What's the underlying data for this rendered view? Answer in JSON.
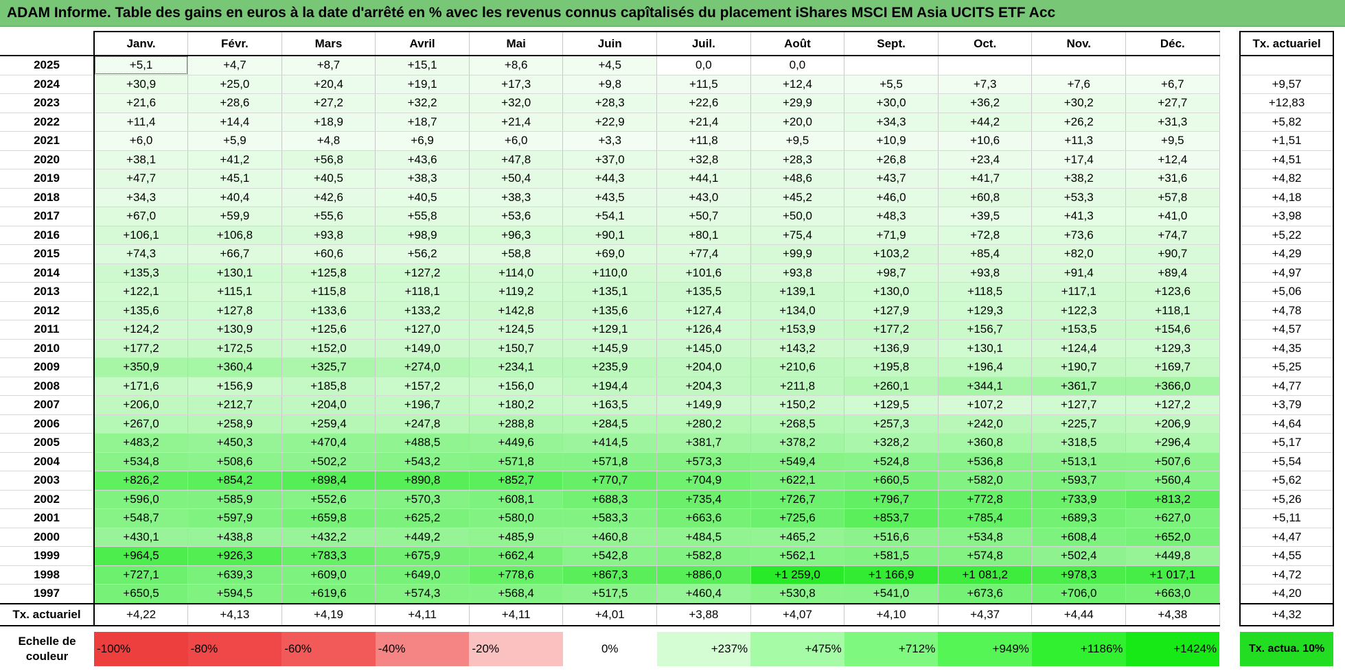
{
  "title": "ADAM Informe. Table des gains en euros à la date d'arrêté en % avec les revenus connus capîtalisés du placement iShares MSCI EM Asia UCITS ETF Acc",
  "months": [
    "Janv.",
    "Févr.",
    "Mars",
    "Avril",
    "Mai",
    "Juin",
    "Juil.",
    "Août",
    "Sept.",
    "Oct.",
    "Nov.",
    "Déc."
  ],
  "actuarial_header": "Tx. actuariel",
  "rows": [
    {
      "year": "2025",
      "values": [
        "+5,1",
        "+4,7",
        "+8,7",
        "+15,1",
        "+8,6",
        "+4,5",
        "0,0",
        "0,0",
        "",
        "",
        "",
        ""
      ],
      "actuarial": ""
    },
    {
      "year": "2024",
      "values": [
        "+30,9",
        "+25,0",
        "+20,4",
        "+19,1",
        "+17,3",
        "+9,8",
        "+11,5",
        "+12,4",
        "+5,5",
        "+7,3",
        "+7,6",
        "+6,7"
      ],
      "actuarial": "+9,57"
    },
    {
      "year": "2023",
      "values": [
        "+21,6",
        "+28,6",
        "+27,2",
        "+32,2",
        "+32,0",
        "+28,3",
        "+22,6",
        "+29,9",
        "+30,0",
        "+36,2",
        "+30,2",
        "+27,7"
      ],
      "actuarial": "+12,83"
    },
    {
      "year": "2022",
      "values": [
        "+11,4",
        "+14,4",
        "+18,9",
        "+18,7",
        "+21,4",
        "+22,9",
        "+21,4",
        "+20,0",
        "+34,3",
        "+44,2",
        "+26,2",
        "+31,3"
      ],
      "actuarial": "+5,82"
    },
    {
      "year": "2021",
      "values": [
        "+6,0",
        "+5,9",
        "+4,8",
        "+6,9",
        "+6,0",
        "+3,3",
        "+11,8",
        "+9,5",
        "+10,9",
        "+10,6",
        "+11,3",
        "+9,5"
      ],
      "actuarial": "+1,51"
    },
    {
      "year": "2020",
      "values": [
        "+38,1",
        "+41,2",
        "+56,8",
        "+43,6",
        "+47,8",
        "+37,0",
        "+32,8",
        "+28,3",
        "+26,8",
        "+23,4",
        "+17,4",
        "+12,4"
      ],
      "actuarial": "+4,51"
    },
    {
      "year": "2019",
      "values": [
        "+47,7",
        "+45,1",
        "+40,5",
        "+38,3",
        "+50,4",
        "+44,3",
        "+44,1",
        "+48,6",
        "+43,7",
        "+41,7",
        "+38,2",
        "+31,6"
      ],
      "actuarial": "+4,82"
    },
    {
      "year": "2018",
      "values": [
        "+34,3",
        "+40,4",
        "+42,6",
        "+40,5",
        "+38,3",
        "+43,5",
        "+43,0",
        "+45,2",
        "+46,0",
        "+60,8",
        "+53,3",
        "+57,8"
      ],
      "actuarial": "+4,18"
    },
    {
      "year": "2017",
      "values": [
        "+67,0",
        "+59,9",
        "+55,6",
        "+55,8",
        "+53,6",
        "+54,1",
        "+50,7",
        "+50,0",
        "+48,3",
        "+39,5",
        "+41,3",
        "+41,0"
      ],
      "actuarial": "+3,98"
    },
    {
      "year": "2016",
      "values": [
        "+106,1",
        "+106,8",
        "+93,8",
        "+98,9",
        "+96,3",
        "+90,1",
        "+80,1",
        "+75,4",
        "+71,9",
        "+72,8",
        "+73,6",
        "+74,7"
      ],
      "actuarial": "+5,22"
    },
    {
      "year": "2015",
      "values": [
        "+74,3",
        "+66,7",
        "+60,6",
        "+56,2",
        "+58,8",
        "+69,0",
        "+77,4",
        "+99,9",
        "+103,2",
        "+85,4",
        "+82,0",
        "+90,7"
      ],
      "actuarial": "+4,29"
    },
    {
      "year": "2014",
      "values": [
        "+135,3",
        "+130,1",
        "+125,8",
        "+127,2",
        "+114,0",
        "+110,0",
        "+101,6",
        "+93,8",
        "+98,7",
        "+93,8",
        "+91,4",
        "+89,4"
      ],
      "actuarial": "+4,97"
    },
    {
      "year": "2013",
      "values": [
        "+122,1",
        "+115,1",
        "+115,8",
        "+118,1",
        "+119,2",
        "+135,1",
        "+135,5",
        "+139,1",
        "+130,0",
        "+118,5",
        "+117,1",
        "+123,6"
      ],
      "actuarial": "+5,06"
    },
    {
      "year": "2012",
      "values": [
        "+135,6",
        "+127,8",
        "+133,6",
        "+133,2",
        "+142,8",
        "+135,6",
        "+127,4",
        "+134,0",
        "+127,9",
        "+129,3",
        "+122,3",
        "+118,1"
      ],
      "actuarial": "+4,78"
    },
    {
      "year": "2011",
      "values": [
        "+124,2",
        "+130,9",
        "+125,6",
        "+127,0",
        "+124,5",
        "+129,1",
        "+126,4",
        "+153,9",
        "+177,2",
        "+156,7",
        "+153,5",
        "+154,6"
      ],
      "actuarial": "+4,57"
    },
    {
      "year": "2010",
      "values": [
        "+177,2",
        "+172,5",
        "+152,0",
        "+149,0",
        "+150,7",
        "+145,9",
        "+145,0",
        "+143,2",
        "+136,9",
        "+130,1",
        "+124,4",
        "+129,3"
      ],
      "actuarial": "+4,35"
    },
    {
      "year": "2009",
      "values": [
        "+350,9",
        "+360,4",
        "+325,7",
        "+274,0",
        "+234,1",
        "+235,9",
        "+204,0",
        "+210,6",
        "+195,8",
        "+196,4",
        "+190,7",
        "+169,7"
      ],
      "actuarial": "+5,25"
    },
    {
      "year": "2008",
      "values": [
        "+171,6",
        "+156,9",
        "+185,8",
        "+157,2",
        "+156,0",
        "+194,4",
        "+204,3",
        "+211,8",
        "+260,1",
        "+344,1",
        "+361,7",
        "+366,0"
      ],
      "actuarial": "+4,77"
    },
    {
      "year": "2007",
      "values": [
        "+206,0",
        "+212,7",
        "+204,0",
        "+196,7",
        "+180,2",
        "+163,5",
        "+149,9",
        "+150,2",
        "+129,5",
        "+107,2",
        "+127,7",
        "+127,2"
      ],
      "actuarial": "+3,79"
    },
    {
      "year": "2006",
      "values": [
        "+267,0",
        "+258,9",
        "+259,4",
        "+247,8",
        "+288,8",
        "+284,5",
        "+280,2",
        "+268,5",
        "+257,3",
        "+242,0",
        "+225,7",
        "+206,9"
      ],
      "actuarial": "+4,64"
    },
    {
      "year": "2005",
      "values": [
        "+483,2",
        "+450,3",
        "+470,4",
        "+488,5",
        "+449,6",
        "+414,5",
        "+381,7",
        "+378,2",
        "+328,2",
        "+360,8",
        "+318,5",
        "+296,4"
      ],
      "actuarial": "+5,17"
    },
    {
      "year": "2004",
      "values": [
        "+534,8",
        "+508,6",
        "+502,2",
        "+543,2",
        "+571,8",
        "+571,8",
        "+573,3",
        "+549,4",
        "+524,8",
        "+536,8",
        "+513,1",
        "+507,6"
      ],
      "actuarial": "+5,54"
    },
    {
      "year": "2003",
      "values": [
        "+826,2",
        "+854,2",
        "+898,4",
        "+890,8",
        "+852,7",
        "+770,7",
        "+704,9",
        "+622,1",
        "+660,5",
        "+582,0",
        "+593,7",
        "+560,4"
      ],
      "actuarial": "+5,62"
    },
    {
      "year": "2002",
      "values": [
        "+596,0",
        "+585,9",
        "+552,6",
        "+570,3",
        "+608,1",
        "+688,3",
        "+735,4",
        "+726,7",
        "+796,7",
        "+772,8",
        "+733,9",
        "+813,2"
      ],
      "actuarial": "+5,26"
    },
    {
      "year": "2001",
      "values": [
        "+548,7",
        "+597,9",
        "+659,8",
        "+625,2",
        "+580,0",
        "+583,3",
        "+663,6",
        "+725,6",
        "+853,7",
        "+785,4",
        "+689,3",
        "+627,0"
      ],
      "actuarial": "+5,11"
    },
    {
      "year": "2000",
      "values": [
        "+430,1",
        "+438,8",
        "+432,2",
        "+449,2",
        "+485,9",
        "+460,8",
        "+484,5",
        "+465,2",
        "+516,6",
        "+534,8",
        "+608,4",
        "+652,0"
      ],
      "actuarial": "+4,47"
    },
    {
      "year": "1999",
      "values": [
        "+964,5",
        "+926,3",
        "+783,3",
        "+675,9",
        "+662,4",
        "+542,8",
        "+582,8",
        "+562,1",
        "+581,5",
        "+574,8",
        "+502,4",
        "+449,8"
      ],
      "actuarial": "+4,55"
    },
    {
      "year": "1998",
      "values": [
        "+727,1",
        "+639,3",
        "+609,0",
        "+649,0",
        "+778,6",
        "+867,3",
        "+886,0",
        "+1 259,0",
        "+1 166,9",
        "+1 081,2",
        "+978,3",
        "+1 017,1"
      ],
      "actuarial": "+4,72"
    },
    {
      "year": "1997",
      "values": [
        "+650,5",
        "+594,5",
        "+619,6",
        "+574,3",
        "+568,4",
        "+517,5",
        "+460,4",
        "+530,8",
        "+541,0",
        "+673,6",
        "+706,0",
        "+663,0"
      ],
      "actuarial": "+4,20"
    }
  ],
  "total_row": {
    "label": "Tx. actuariel",
    "values": [
      "+4,22",
      "+4,13",
      "+4,19",
      "+4,11",
      "+4,11",
      "+4,01",
      "+3,88",
      "+4,07",
      "+4,10",
      "+4,37",
      "+4,44",
      "+4,38"
    ],
    "actuarial": "+4,32"
  },
  "legend": {
    "label": "Echelle de couleur",
    "items": [
      {
        "text": "-100%",
        "color": "#ee3f3f",
        "align": "left"
      },
      {
        "text": "-80%",
        "color": "#f04848",
        "align": "left"
      },
      {
        "text": "-60%",
        "color": "#f25a5a",
        "align": "left"
      },
      {
        "text": "-40%",
        "color": "#f58585",
        "align": "left"
      },
      {
        "text": "-20%",
        "color": "#fbc0c0",
        "align": "left"
      },
      {
        "text": "0%",
        "color": "#ffffff",
        "align": "center"
      },
      {
        "text": "+237%",
        "color": "#d4fdd4",
        "align": "right"
      },
      {
        "text": "+475%",
        "color": "#a6fba6",
        "align": "right"
      },
      {
        "text": "+712%",
        "color": "#7ef87e",
        "align": "right"
      },
      {
        "text": "+949%",
        "color": "#55f555",
        "align": "right"
      },
      {
        "text": "+1186%",
        "color": "#30f030",
        "align": "right"
      },
      {
        "text": "+1424%",
        "color": "#17e917",
        "align": "right"
      }
    ],
    "actuarial_label": "Tx. actua. 10%",
    "actuarial_color": "#22dd22"
  },
  "colors": {
    "title_bar": "#77c777",
    "scale_max_percent": 1424
  }
}
